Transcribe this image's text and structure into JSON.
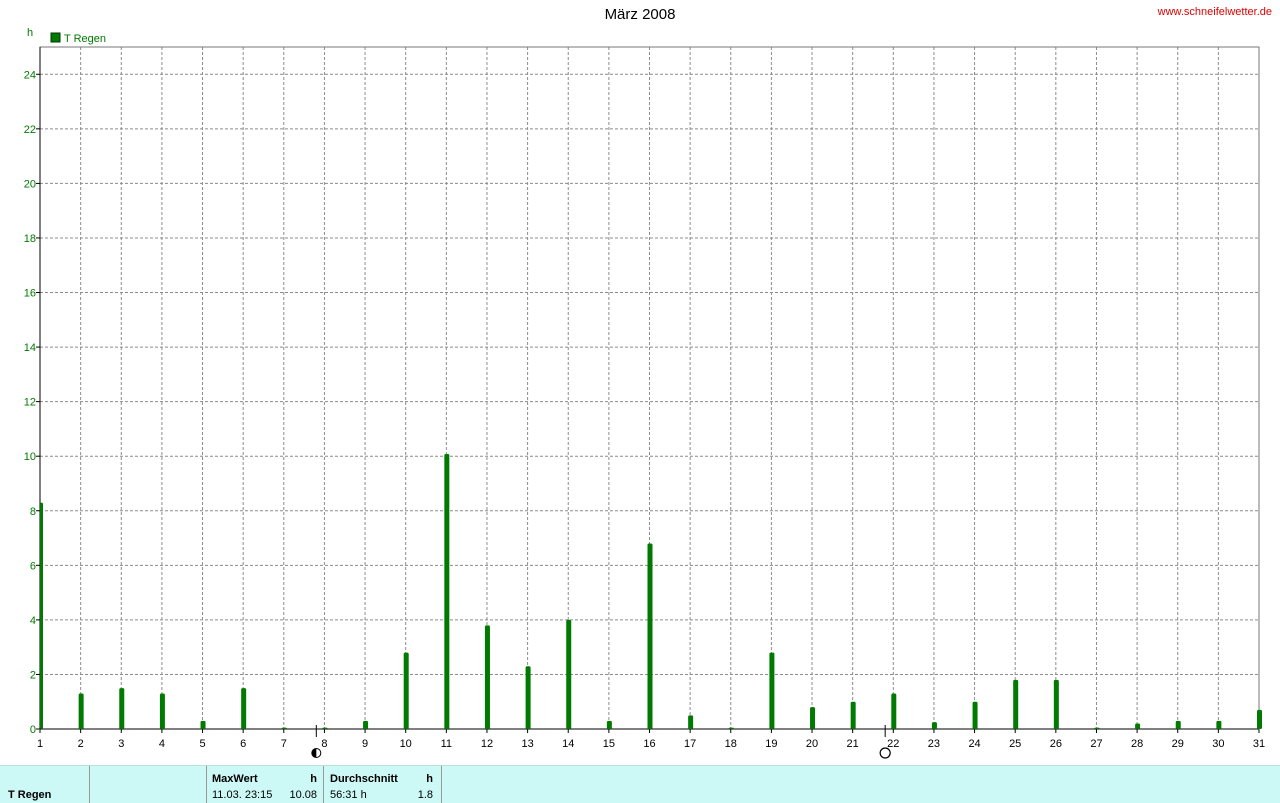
{
  "title": "März 2008",
  "site": "www.schneifelwetter.de",
  "chart_data": {
    "type": "bar",
    "title": "März 2008",
    "ylabel": "h",
    "xlabel": "",
    "ylim": [
      0,
      25
    ],
    "yticks": [
      0,
      2,
      4,
      6,
      8,
      10,
      12,
      14,
      16,
      18,
      20,
      22,
      24
    ],
    "xlim": [
      1,
      31
    ],
    "xticks": [
      1,
      2,
      3,
      4,
      5,
      6,
      7,
      8,
      9,
      10,
      11,
      12,
      13,
      14,
      15,
      16,
      17,
      18,
      19,
      20,
      21,
      22,
      23,
      24,
      25,
      26,
      27,
      28,
      29,
      30,
      31
    ],
    "grid": true,
    "legend_position": "top-left",
    "x": [
      1,
      2,
      3,
      4,
      5,
      6,
      7,
      8,
      9,
      10,
      11,
      12,
      13,
      14,
      15,
      16,
      17,
      18,
      19,
      20,
      21,
      22,
      23,
      24,
      25,
      26,
      27,
      28,
      29,
      30,
      31
    ],
    "series": [
      {
        "name": "T Regen",
        "color": "#007a00",
        "values": [
          8.3,
          1.3,
          1.5,
          1.3,
          0.3,
          1.5,
          0.05,
          0.05,
          0.3,
          2.8,
          10.08,
          3.8,
          2.3,
          4.0,
          0.3,
          6.8,
          0.5,
          0.05,
          2.8,
          0.8,
          1.0,
          1.3,
          0.25,
          1.0,
          1.8,
          1.8,
          0.05,
          0.2,
          0.3,
          0.3,
          0.7
        ]
      }
    ],
    "moon_phases": [
      {
        "day": 7.8,
        "phase": "half-moon-icon"
      },
      {
        "day": 21.8,
        "phase": "full-moon-icon"
      }
    ]
  },
  "info": {
    "series_name": "T Regen",
    "max_header": "MaxWert",
    "max_unit": "h",
    "max_datetime": "11.03.  23:15",
    "max_value": "10.08",
    "avg_header": "Durchschnitt",
    "avg_unit": "h",
    "avg_total": "56:31 h",
    "avg_value": "1.8"
  }
}
